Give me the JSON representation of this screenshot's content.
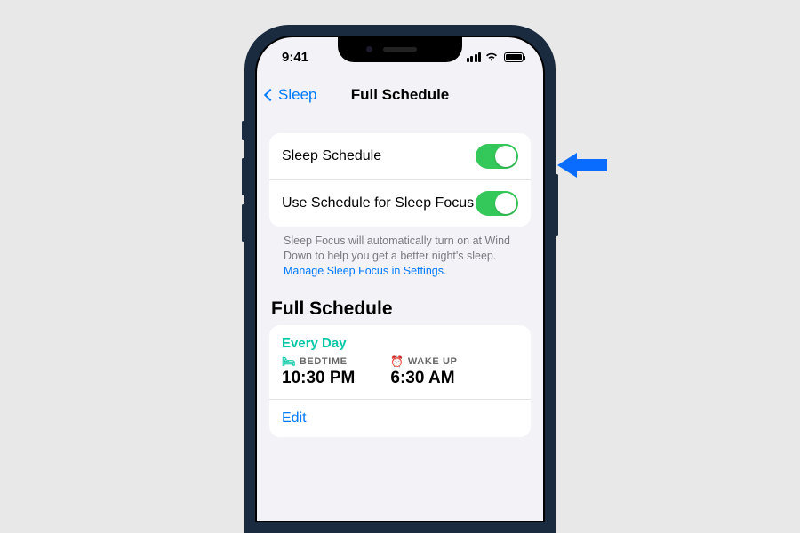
{
  "status": {
    "time": "9:41"
  },
  "nav": {
    "back_label": "Sleep",
    "title": "Full Schedule"
  },
  "toggles": {
    "sleep_schedule_label": "Sleep Schedule",
    "sleep_schedule_on": true,
    "use_focus_label": "Use Schedule for Sleep Focus",
    "use_focus_on": true
  },
  "footnote": {
    "text": "Sleep Focus will automatically turn on at Wind Down to help you get a better night's sleep. ",
    "link_text": "Manage Sleep Focus in Settings."
  },
  "section": {
    "title": "Full Schedule"
  },
  "schedule": {
    "recurrence": "Every Day",
    "bedtime_label": "BEDTIME",
    "bedtime_value": "10:30 PM",
    "wake_label": "WAKE UP",
    "wake_value": "6:30 AM",
    "edit_label": "Edit"
  },
  "colors": {
    "ios_blue": "#007aff",
    "ios_green": "#34c759",
    "teal": "#00c7a5",
    "callout_blue": "#0a6bff"
  }
}
